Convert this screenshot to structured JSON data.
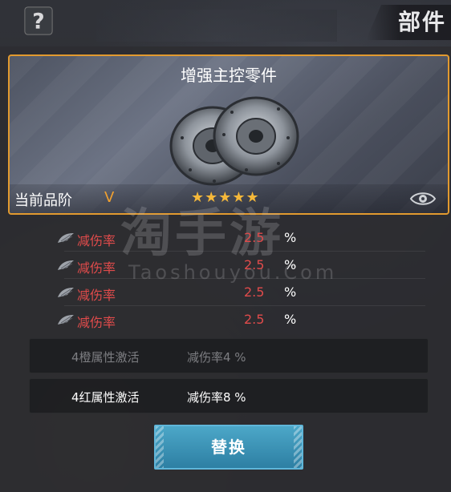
{
  "header": {
    "title": "部件",
    "help_icon": "question-mark-icon"
  },
  "part_card": {
    "name": "增强主控零件",
    "image": "brake-disc-icon",
    "rank_label": "当前品阶",
    "rank_value": "V",
    "stars": "★★★★★",
    "star_count": 5,
    "view_icon": "eye-icon",
    "border_color": "#e29a2f"
  },
  "stats": [
    {
      "icon": "wing-icon",
      "name": "减伤率",
      "value": "2.5",
      "unit": "%"
    },
    {
      "icon": "wing-icon",
      "name": "减伤率",
      "value": "2.5",
      "unit": "%"
    },
    {
      "icon": "wing-icon",
      "name": "减伤率",
      "value": "2.5",
      "unit": "%"
    },
    {
      "icon": "wing-icon",
      "name": "减伤率",
      "value": "2.5",
      "unit": "%"
    }
  ],
  "set_bonuses": [
    {
      "condition": "4橙属性激活",
      "effect": "减伤率4 %",
      "active": false
    },
    {
      "condition": "4红属性激活",
      "effect": "减伤率8 %",
      "active": true
    }
  ],
  "watermark": {
    "main": "淘手游",
    "sub": "Taoshouyou.Com"
  },
  "replace_button": {
    "label": "替换"
  },
  "colors": {
    "stat_red": "#e04b4b",
    "accent_orange": "#f0a030",
    "button_blue": "#2d7fa3"
  }
}
